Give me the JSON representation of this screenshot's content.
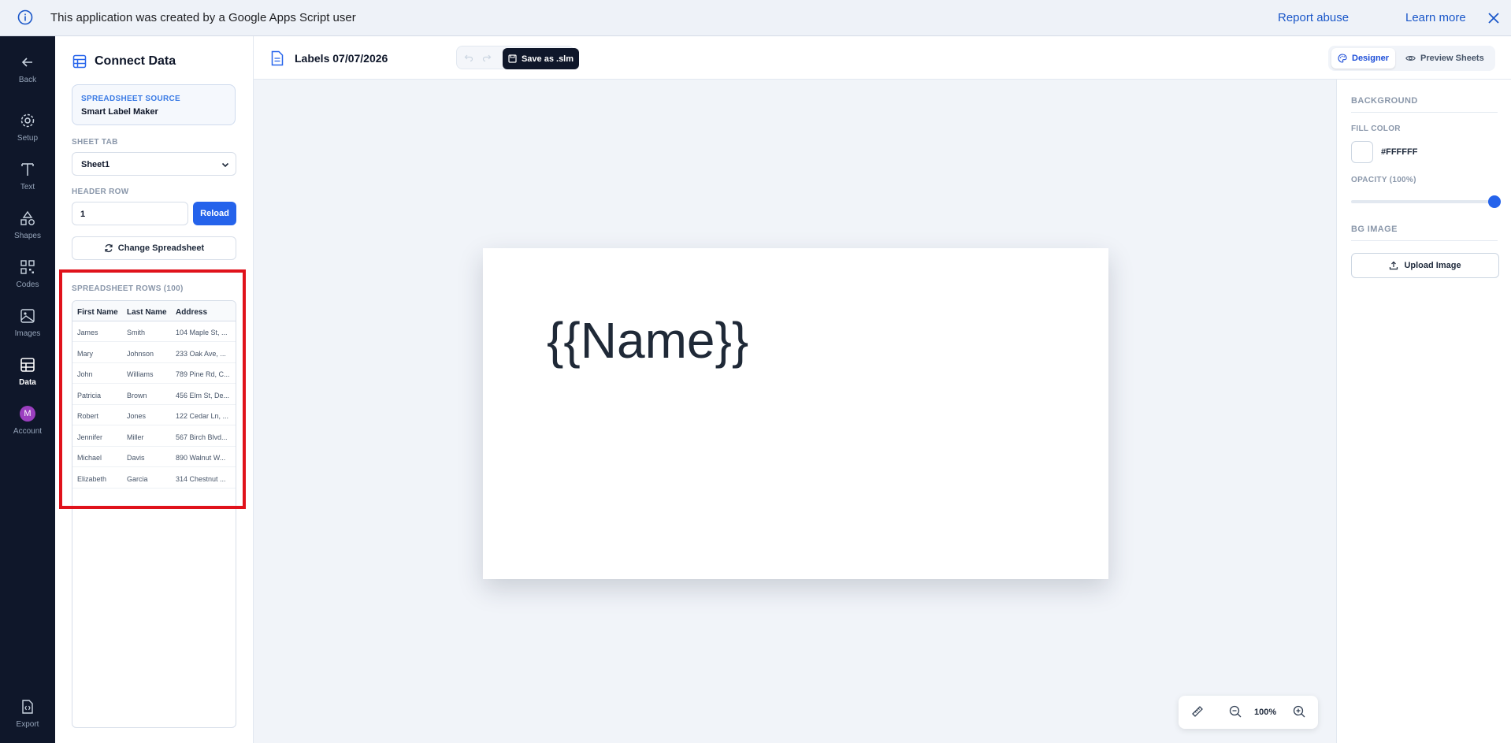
{
  "banner": {
    "message": "This application was created by a Google Apps Script user",
    "report_abuse": "Report abuse",
    "learn_more": "Learn more"
  },
  "rail": {
    "items": [
      {
        "label": "Back",
        "icon": "arrow-left-icon"
      },
      {
        "label": "Setup",
        "icon": "gear-icon"
      },
      {
        "label": "Text",
        "icon": "text-icon"
      },
      {
        "label": "Shapes",
        "icon": "shapes-icon"
      },
      {
        "label": "Codes",
        "icon": "qr-code-icon"
      },
      {
        "label": "Images",
        "icon": "image-icon"
      },
      {
        "label": "Data",
        "icon": "table-icon",
        "active": true
      },
      {
        "label": "Account",
        "icon": "avatar",
        "avatar_letter": "M"
      },
      {
        "label": "Export",
        "icon": "export-code-icon"
      }
    ]
  },
  "panel": {
    "title": "Connect Data",
    "source_label": "SPREADSHEET SOURCE",
    "source_value": "Smart Label Maker",
    "sheet_tab_label": "SHEET TAB",
    "sheet_tab_value": "Sheet1",
    "header_row_label": "HEADER ROW",
    "header_row_value": "1",
    "reload_label": "Reload",
    "change_label": "Change Spreadsheet",
    "rows_title": "SPREADSHEET ROWS (100)",
    "columns": [
      "First Name",
      "Last Name",
      "Address"
    ],
    "rows": [
      [
        "James",
        "Smith",
        "104 Maple St, ..."
      ],
      [
        "Mary",
        "Johnson",
        "233 Oak Ave, ..."
      ],
      [
        "John",
        "Williams",
        "789 Pine Rd, C..."
      ],
      [
        "Patricia",
        "Brown",
        "456 Elm St, De..."
      ],
      [
        "Robert",
        "Jones",
        "122 Cedar Ln, ..."
      ],
      [
        "Jennifer",
        "Miller",
        "567 Birch Blvd..."
      ],
      [
        "Michael",
        "Davis",
        "890 Walnut W..."
      ],
      [
        "Elizabeth",
        "Garcia",
        "314 Chestnut ..."
      ]
    ]
  },
  "topbar": {
    "doc_title": "Labels 07/07/2026",
    "save_label": "Save as .slm",
    "designer_label": "Designer",
    "preview_label": "Preview Sheets"
  },
  "canvas": {
    "label_text": "{{Name}}",
    "zoom": "100%"
  },
  "right_panel": {
    "background_heading": "BACKGROUND",
    "fill_color_label": "FILL COLOR",
    "fill_color_value": "#FFFFFF",
    "opacity_label": "OPACITY (100%)",
    "opacity": 1.0,
    "bg_image_heading": "BG IMAGE",
    "upload_label": "Upload Image"
  },
  "colors": {
    "accent": "#2563eb",
    "rail_bg": "#0f172a",
    "highlight": "#e0121b"
  }
}
